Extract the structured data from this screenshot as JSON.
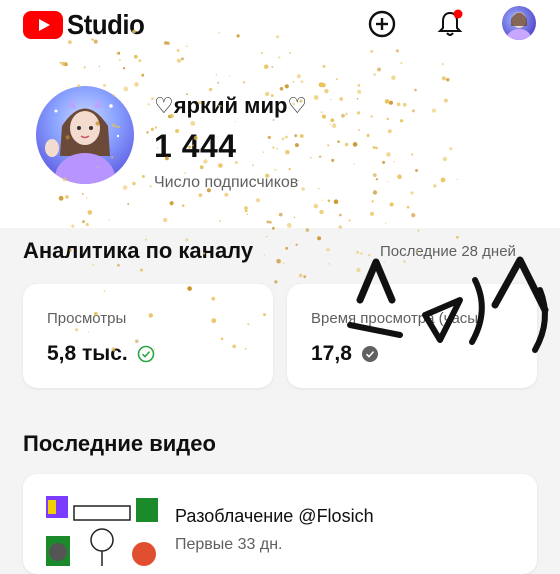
{
  "header": {
    "logo_text": "Studio",
    "brand_color": "#ff0000",
    "icons": [
      "create-icon",
      "notification-bell-icon",
      "account-avatar"
    ],
    "notification_dot_color": "#ff0000"
  },
  "channel": {
    "name": "♡яркий мир♡",
    "subscriber_count": "1 444",
    "subscriber_label": "Число подписчиков"
  },
  "analytics": {
    "title": "Аналитика по каналу",
    "period": "Последние 28 дней",
    "cards": [
      {
        "label": "Просмотры",
        "value": "5,8 тыс.",
        "icon": "check-circle-icon",
        "icon_color": "#2ba640"
      },
      {
        "label": "Время просмотра (часы)",
        "value": "17,8",
        "icon": "check-circle-icon",
        "icon_color": "#606060"
      }
    ]
  },
  "recent_videos": {
    "title": "Последние видео",
    "items": [
      {
        "title": "Разоблачение @Flosich",
        "meta": "Первые 33 дн."
      }
    ]
  }
}
